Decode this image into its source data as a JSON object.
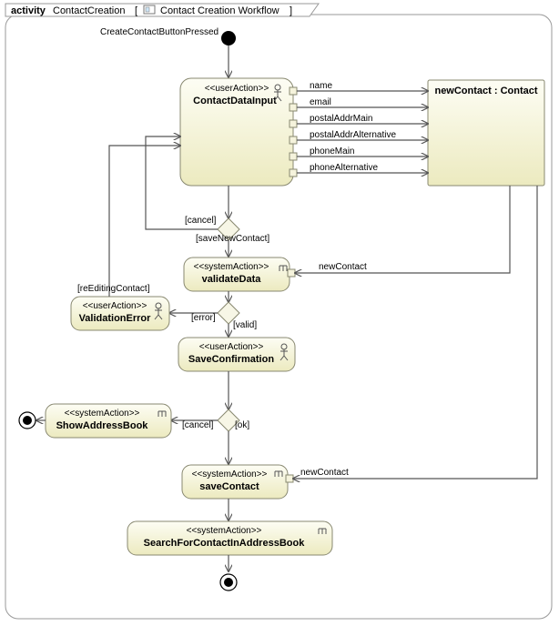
{
  "frame": {
    "kind": "activity",
    "name": "ContactCreation",
    "subtitle": "Contact Creation Workflow"
  },
  "initialLabel": "CreateContactButtonPressed",
  "nodes": {
    "input": {
      "stereotype": "<<userAction>>",
      "name": "ContactDataInput"
    },
    "object": {
      "name": "newContact : Contact"
    },
    "validate": {
      "stereotype": "<<systemAction>>",
      "name": "validateData"
    },
    "valErr": {
      "stereotype": "<<userAction>>",
      "name": "ValidationError"
    },
    "saveConf": {
      "stereotype": "<<userAction>>",
      "name": "SaveConfirmation"
    },
    "showAB": {
      "stereotype": "<<systemAction>>",
      "name": "ShowAddressBook"
    },
    "saveContact": {
      "stereotype": "<<systemAction>>",
      "name": "saveContact"
    },
    "search": {
      "stereotype": "<<systemAction>>",
      "name": "SearchForContactInAddressBook"
    }
  },
  "edgeLabels": {
    "name": "name",
    "email": "email",
    "postalMain": "postalAddrMain",
    "postalAlt": "postalAddrAlternative",
    "phoneMain": "phoneMain",
    "phoneAlt": "phoneAlternative",
    "newContact1": "newContact",
    "newContact2": "newContact"
  },
  "guards": {
    "cancel1": "[cancel]",
    "saveNew": "[saveNewContact]",
    "error": "[error]",
    "valid": "[valid]",
    "reEdit": "[reEditingContact]",
    "cancel2": "[cancel]",
    "ok": "[ok]"
  },
  "chart_data": {
    "type": "uml-activity",
    "frame": "activity ContactCreation [ Contact Creation Workflow ]",
    "initial": "CreateContactButtonPressed",
    "actions": [
      {
        "id": "ContactDataInput",
        "stereotype": "userAction"
      },
      {
        "id": "validateData",
        "stereotype": "systemAction"
      },
      {
        "id": "ValidationError",
        "stereotype": "userAction"
      },
      {
        "id": "SaveConfirmation",
        "stereotype": "userAction"
      },
      {
        "id": "ShowAddressBook",
        "stereotype": "systemAction"
      },
      {
        "id": "saveContact",
        "stereotype": "systemAction"
      },
      {
        "id": "SearchForContactInAddressBook",
        "stereotype": "systemAction"
      }
    ],
    "objects": [
      {
        "id": "newContact",
        "type": "Contact"
      }
    ],
    "decisions": [
      "d1",
      "d2",
      "d3"
    ],
    "finals": [
      "f1",
      "f2"
    ],
    "flows": [
      {
        "from": "initial",
        "to": "ContactDataInput"
      },
      {
        "from": "ContactDataInput",
        "to": "newContact",
        "label": "name"
      },
      {
        "from": "ContactDataInput",
        "to": "newContact",
        "label": "email"
      },
      {
        "from": "ContactDataInput",
        "to": "newContact",
        "label": "postalAddrMain"
      },
      {
        "from": "ContactDataInput",
        "to": "newContact",
        "label": "postalAddrAlternative"
      },
      {
        "from": "ContactDataInput",
        "to": "newContact",
        "label": "phoneMain"
      },
      {
        "from": "ContactDataInput",
        "to": "newContact",
        "label": "phoneAlternative"
      },
      {
        "from": "ContactDataInput",
        "to": "d1"
      },
      {
        "from": "d1",
        "to": "left-reentry",
        "guard": "[cancel]"
      },
      {
        "from": "d1",
        "to": "validateData",
        "guard": "[saveNewContact]"
      },
      {
        "from": "newContact",
        "to": "validateData",
        "label": "newContact"
      },
      {
        "from": "validateData",
        "to": "d2"
      },
      {
        "from": "d2",
        "to": "ValidationError",
        "guard": "[error]"
      },
      {
        "from": "d2",
        "to": "SaveConfirmation",
        "guard": "[valid]"
      },
      {
        "from": "ValidationError",
        "to": "ContactDataInput",
        "guard": "[reEditingContact]"
      },
      {
        "from": "SaveConfirmation",
        "to": "d3"
      },
      {
        "from": "d3",
        "to": "ShowAddressBook",
        "guard": "[cancel]"
      },
      {
        "from": "d3",
        "to": "saveContact",
        "guard": "[ok]"
      },
      {
        "from": "ShowAddressBook",
        "to": "f1"
      },
      {
        "from": "newContact",
        "to": "saveContact",
        "label": "newContact"
      },
      {
        "from": "saveContact",
        "to": "SearchForContactInAddressBook"
      },
      {
        "from": "SearchForContactInAddressBook",
        "to": "f2"
      }
    ]
  }
}
